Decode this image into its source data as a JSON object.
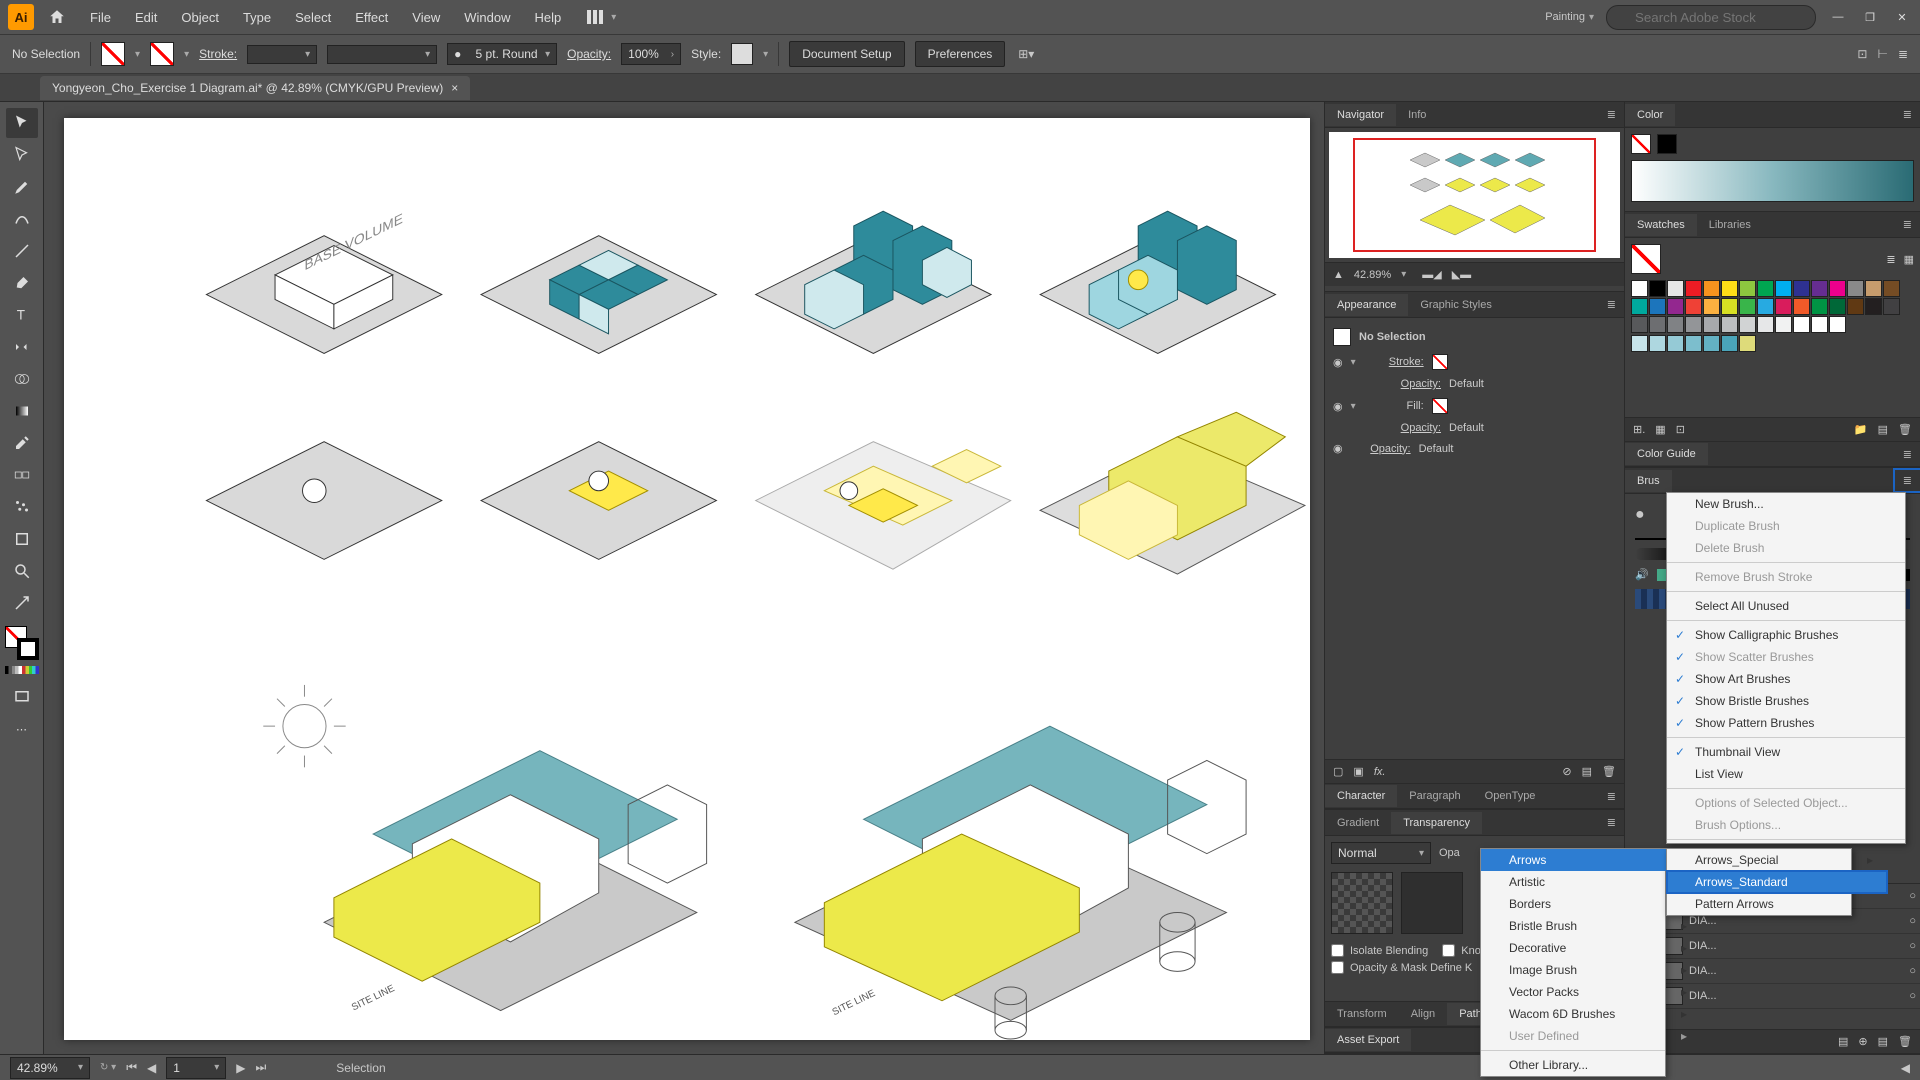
{
  "menubar": {
    "items": [
      "File",
      "Edit",
      "Object",
      "Type",
      "Select",
      "Effect",
      "View",
      "Window",
      "Help"
    ],
    "workspace": "Painting",
    "stock_placeholder": "Search Adobe Stock"
  },
  "controlbar": {
    "selection_state": "No Selection",
    "stroke_label": "Stroke:",
    "stroke_weight": "",
    "brush_def": "5 pt. Round",
    "opacity_label": "Opacity:",
    "opacity_value": "100%",
    "style_label": "Style:",
    "doc_setup": "Document Setup",
    "preferences": "Preferences"
  },
  "doc_tab": "Yongyeon_Cho_Exercise 1 Diagram.ai* @ 42.89% (CMYK/GPU Preview)",
  "navigator": {
    "tab1": "Navigator",
    "tab2": "Info",
    "zoom": "42.89%"
  },
  "appearance": {
    "tab1": "Appearance",
    "tab2": "Graphic Styles",
    "no_sel": "No Selection",
    "stroke": "Stroke:",
    "fill": "Fill:",
    "opacity_label": "Opacity:",
    "opacity_default": "Default"
  },
  "character": {
    "tab1": "Character",
    "tab2": "Paragraph",
    "tab3": "OpenType"
  },
  "transparency": {
    "tab1": "Gradient",
    "tab2": "Transparency",
    "mode": "Normal",
    "op_label": "Opa",
    "isolate": "Isolate Blending",
    "knock": "Kno",
    "mask_define": "Opacity & Mask Define K"
  },
  "transform_bar": {
    "tab1": "Transform",
    "tab2": "Align",
    "tab3": "Path"
  },
  "asset_export": "Asset Export",
  "color": {
    "tab": "Color"
  },
  "swatches": {
    "tab1": "Swatches",
    "tab2": "Libraries"
  },
  "color_guide": {
    "tab": "Color Guide"
  },
  "brushes_tab": "Brus",
  "layers_rows": [
    "DIA...",
    "DIA...",
    "DIA...",
    "DIA...",
    "DIA..."
  ],
  "brush_menu": {
    "items": [
      {
        "label": "New Brush...",
        "enabled": true
      },
      {
        "label": "Duplicate Brush",
        "enabled": false
      },
      {
        "label": "Delete Brush",
        "enabled": false
      },
      {
        "sep": true
      },
      {
        "label": "Remove Brush Stroke",
        "enabled": false
      },
      {
        "sep": true
      },
      {
        "label": "Select All Unused",
        "enabled": true
      },
      {
        "sep": true
      },
      {
        "label": "Show Calligraphic Brushes",
        "enabled": true,
        "checked": true
      },
      {
        "label": "Show Scatter Brushes",
        "enabled": false,
        "checked": true
      },
      {
        "label": "Show Art Brushes",
        "enabled": true,
        "checked": true
      },
      {
        "label": "Show Bristle Brushes",
        "enabled": true,
        "checked": true
      },
      {
        "label": "Show Pattern Brushes",
        "enabled": true,
        "checked": true
      },
      {
        "sep": true
      },
      {
        "label": "Thumbnail View",
        "enabled": true,
        "checked": true
      },
      {
        "label": "List View",
        "enabled": true
      },
      {
        "sep": true
      },
      {
        "label": "Options of Selected Object...",
        "enabled": false
      },
      {
        "label": "Brush Options...",
        "enabled": false
      },
      {
        "sep": true
      }
    ]
  },
  "brush_lib_menu": {
    "items": [
      {
        "label": "Arrows",
        "sub": true,
        "hl": true
      },
      {
        "label": "Artistic",
        "sub": true
      },
      {
        "label": "Borders",
        "sub": true
      },
      {
        "label": "Bristle Brush",
        "sub": true
      },
      {
        "label": "Decorative",
        "sub": true
      },
      {
        "label": "Image Brush",
        "sub": true
      },
      {
        "label": "Vector Packs",
        "sub": true
      },
      {
        "label": "Wacom 6D Brushes",
        "sub": true
      },
      {
        "label": "User Defined",
        "sub": true,
        "enabled": false
      },
      {
        "sep": true
      },
      {
        "label": "Other Library..."
      }
    ]
  },
  "brush_sub_menu": {
    "items": [
      {
        "label": "Arrows_Special",
        "sub": true
      },
      {
        "label": "Arrows_Standard",
        "hl": true,
        "border": true
      },
      {
        "label": "Pattern Arrows"
      }
    ]
  },
  "statusbar": {
    "zoom": "42.89%",
    "artboard_nav": "1",
    "tool": "Selection"
  },
  "swatch_colors": [
    "#ffffff",
    "#000000",
    "#e6e6e6",
    "#ed1c24",
    "#f7931e",
    "#ffde17",
    "#8dc63f",
    "#00a651",
    "#00aeef",
    "#2e3192",
    "#662d91",
    "#ec008c",
    "#898989",
    "#c69c6d",
    "#754c24",
    "#00a99d",
    "#1c75bc",
    "#93278f",
    "#ef4136",
    "#fbb040",
    "#d7df23",
    "#39b54a",
    "#27aae1",
    "#d91c5c",
    "#f15a29",
    "#009444",
    "#006838",
    "#603913",
    "#231f20",
    "#414042",
    "#58595b",
    "#6d6e71",
    "#808285",
    "#939598",
    "#a7a9ac",
    "#bcbec0",
    "#d1d3d4",
    "#e6e7e8",
    "#f1f2f2",
    "#ffffff",
    "#ffffff",
    "#ffffff"
  ],
  "guide_colors": [
    "#d93f3a",
    "#e27058",
    "#e78f6f",
    "#edac8b",
    "#f2c8a8",
    "#f6e3c7"
  ],
  "guide_tints": [
    "#c7e4ea",
    "#aed7e0",
    "#95cad6",
    "#7cbecd",
    "#63b1c3",
    "#4aa4b9",
    "#dedb7a"
  ]
}
